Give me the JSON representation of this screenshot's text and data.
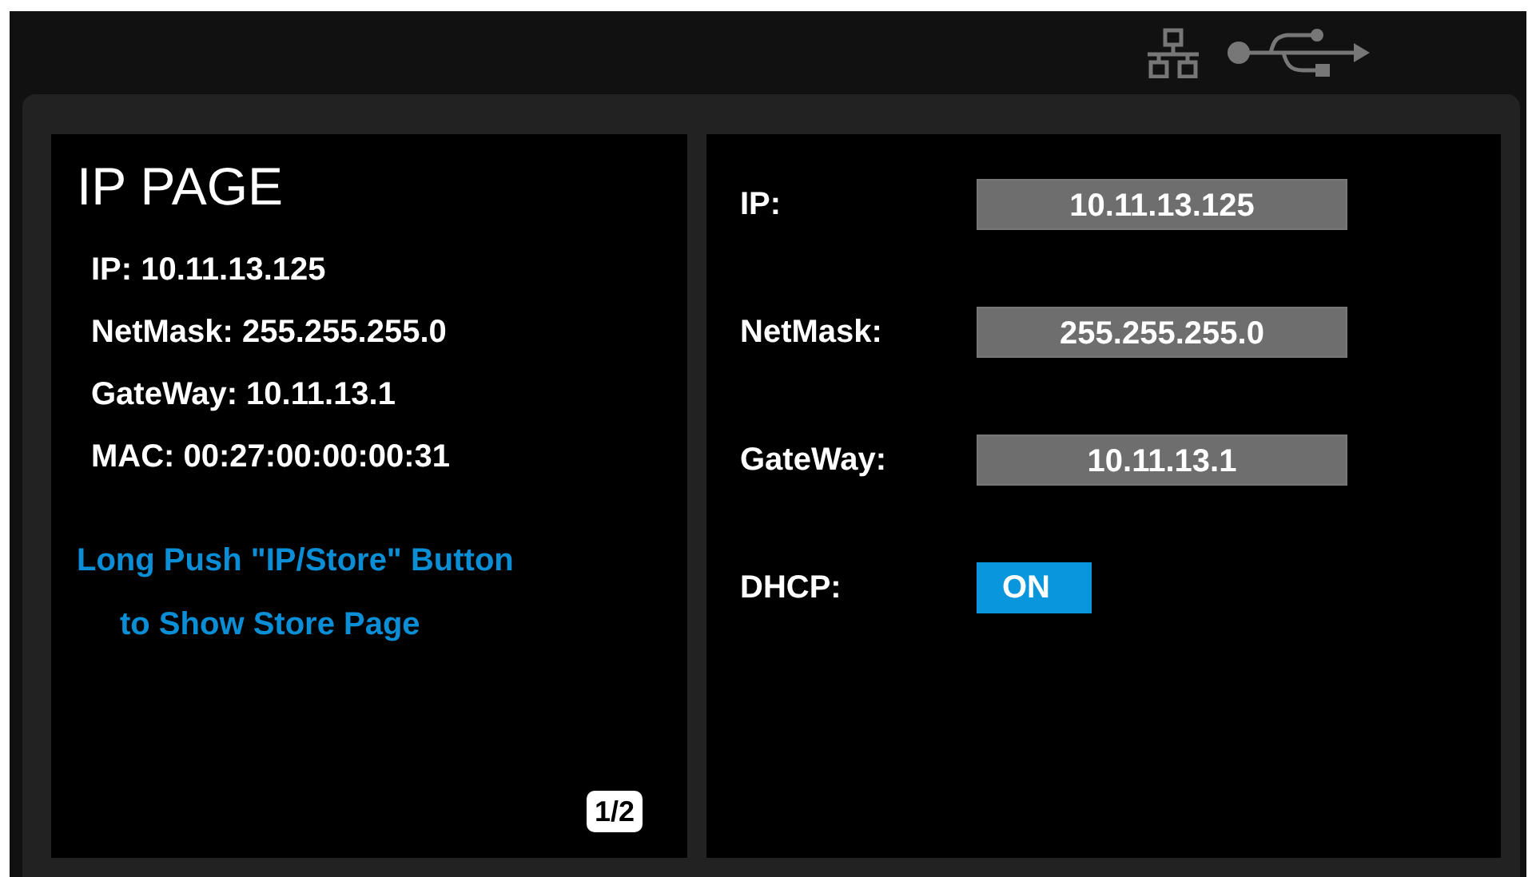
{
  "status_icons": [
    {
      "kind": "network"
    },
    {
      "kind": "usb"
    }
  ],
  "info_panel": {
    "title": "IP PAGE",
    "lines": [
      "IP: 10.11.13.125",
      "NetMask: 255.255.255.0",
      "GateWay: 10.11.13.1",
      "MAC: 00:27:00:00:00:31"
    ],
    "hint": [
      "Long Push \"IP/Store\" Button",
      "to Show Store Page"
    ],
    "page": "1/2"
  },
  "settings": [
    {
      "label": "IP:",
      "kind": "value",
      "value": "10.11.13.125"
    },
    {
      "label": "NetMask:",
      "kind": "value",
      "value": "255.255.255.0"
    },
    {
      "label": "GateWay:",
      "kind": "value",
      "value": "10.11.13.1"
    },
    {
      "label": "DHCP:",
      "kind": "toggle",
      "value": "ON",
      "on": true
    }
  ]
}
